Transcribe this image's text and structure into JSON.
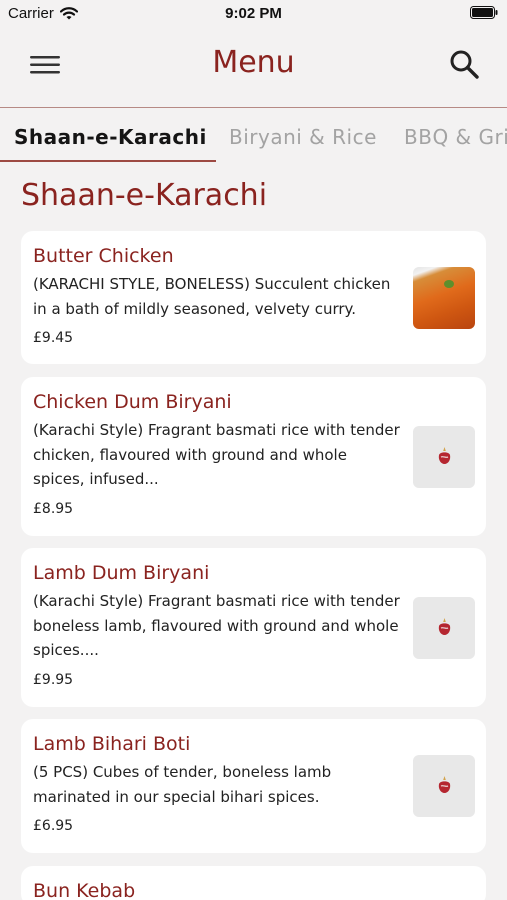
{
  "status_bar": {
    "carrier": "Carrier",
    "time": "9:02 PM"
  },
  "header": {
    "title": "Menu",
    "menu_icon": "hamburger-icon",
    "search_icon": "search-icon"
  },
  "tabs": [
    {
      "label": "Shaan-e-Karachi",
      "active": true
    },
    {
      "label": "Biryani & Rice",
      "active": false
    },
    {
      "label": "BBQ & Gri",
      "active": false
    }
  ],
  "section": {
    "title": "Shaan-e-Karachi"
  },
  "items": [
    {
      "name": "Butter Chicken",
      "description": "(KARACHI STYLE, BONELESS) Succulent chicken in a bath of mildly seasoned, velvety curry.",
      "price": "£9.45",
      "image": "curry-photo"
    },
    {
      "name": "Chicken Dum Biryani",
      "description": "(Karachi Style) Fragrant basmati rice with tender chicken, flavoured with ground and whole spices, infused...",
      "price": "£8.95",
      "image": "placeholder-logo"
    },
    {
      "name": "Lamb Dum Biryani",
      "description": "(Karachi Style) Fragrant basmati rice with tender boneless lamb, flavoured with ground and whole spices....",
      "price": "£9.95",
      "image": "placeholder-logo"
    },
    {
      "name": "Lamb Bihari Boti",
      "description": "(5 PCS) Cubes of tender, boneless lamb marinated in our special bihari spices.",
      "price": "£6.95",
      "image": "placeholder-logo"
    },
    {
      "name": "Bun Kebab",
      "description": "",
      "price": "",
      "image": ""
    }
  ],
  "colors": {
    "brand": "#8a231f",
    "background": "#f3f2f2",
    "card": "#ffffff",
    "inactive_tab": "#a3a3a3"
  }
}
